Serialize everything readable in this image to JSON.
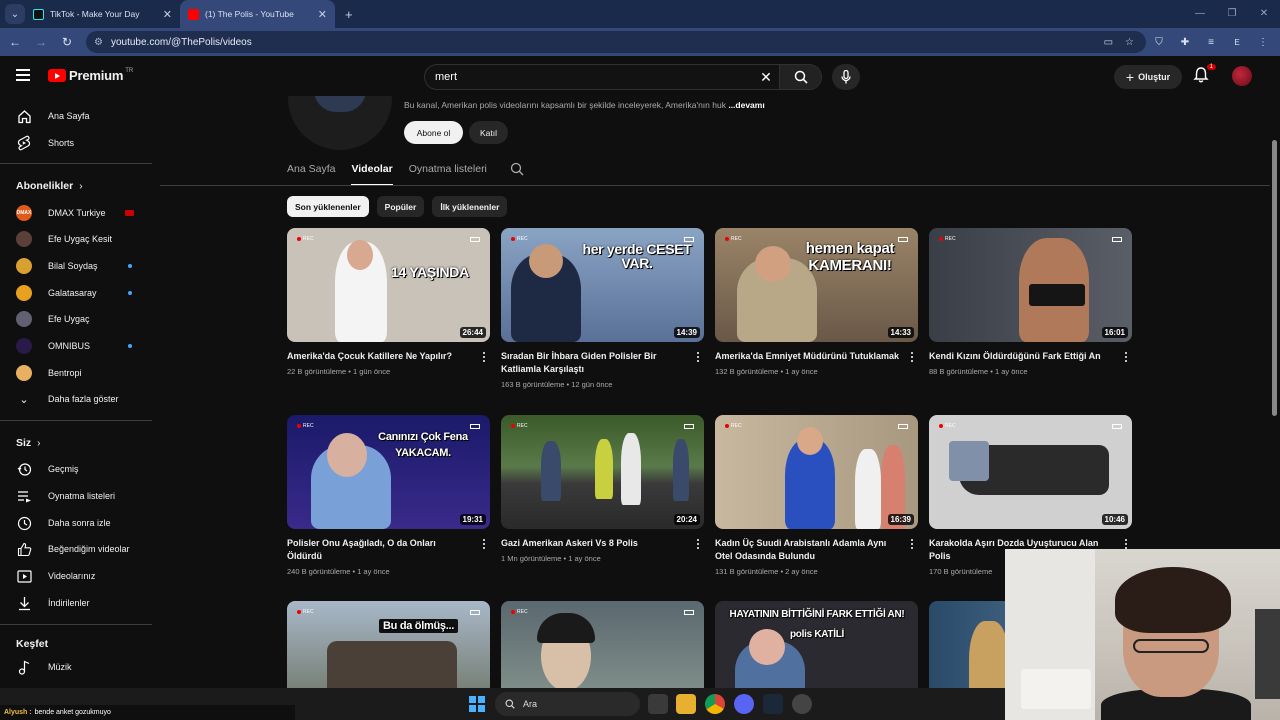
{
  "browser": {
    "tabs": [
      {
        "title": "TikTok - Make Your Day",
        "active": false
      },
      {
        "title": "(1) The Polis - YouTube",
        "active": true
      }
    ],
    "url": "youtube.com/@ThePolis/videos",
    "profile_letter": "E"
  },
  "header": {
    "logo_text": "Premium",
    "country_code": "TR",
    "search_value": "mert",
    "create_label": "Oluştur",
    "notification_count": "1"
  },
  "sidebar": {
    "main": [
      {
        "label": "Ana Sayfa",
        "icon": "home-icon"
      },
      {
        "label": "Shorts",
        "icon": "shorts-icon"
      }
    ],
    "subscriptions_heading": "Abonelikler",
    "subscriptions": [
      {
        "label": "DMAX Turkiye",
        "avatar_text": "DMAX",
        "color": "#e05a1a",
        "status": "live"
      },
      {
        "label": "Efe Uygaç Kesit",
        "avatar_text": "",
        "color": "#5a4038",
        "status": ""
      },
      {
        "label": "Bilal Soydaş",
        "avatar_text": "",
        "color": "#d8a030",
        "status": "new"
      },
      {
        "label": "Galatasaray",
        "avatar_text": "",
        "color": "#e8a020",
        "status": "new"
      },
      {
        "label": "Efe Uygaç",
        "avatar_text": "",
        "color": "#606070",
        "status": ""
      },
      {
        "label": "OMNIBUS",
        "avatar_text": "",
        "color": "#2a1a4a",
        "status": "new"
      },
      {
        "label": "Bentropi",
        "avatar_text": "",
        "color": "#e8b060",
        "status": ""
      }
    ],
    "show_more_label": "Daha fazla göster",
    "you_heading": "Siz",
    "you": [
      {
        "label": "Geçmiş",
        "icon": "history-icon"
      },
      {
        "label": "Oynatma listeleri",
        "icon": "playlists-icon"
      },
      {
        "label": "Daha sonra izle",
        "icon": "watch-later-icon"
      },
      {
        "label": "Beğendiğim videolar",
        "icon": "like-icon"
      },
      {
        "label": "Videolarınız",
        "icon": "your-videos-icon"
      },
      {
        "label": "İndirilenler",
        "icon": "download-icon"
      }
    ],
    "explore_heading": "Keşfet",
    "explore": [
      {
        "label": "Müzik",
        "icon": "music-icon"
      }
    ]
  },
  "channel": {
    "description": "Bu kanal, Amerikan polis videolarını kapsamlı bir şekilde inceleyerek, Amerika'nın huk",
    "more_label": "...devamı",
    "subscribe_label": "Abone ol",
    "join_label": "Katıl",
    "tabs": [
      "Ana Sayfa",
      "Videolar",
      "Oynatma listeleri"
    ],
    "active_tab": "Videolar",
    "chips": [
      "Son yüklenenler",
      "Popüler",
      "İlk yüklenenler"
    ]
  },
  "videos": [
    {
      "title": "Amerika'da Çocuk Katillere Ne Yapılır?",
      "stats": "22 B görüntüleme • 1 gün önce",
      "duration": "26:44",
      "caption": "14 YAŞINDA",
      "bg": "#c9c2b8",
      "fig": "#f4f4f4"
    },
    {
      "title": "Sıradan Bir İhbara Giden Polisler Bir Katliamla Karşılaştı",
      "stats": "163 B görüntüleme • 12 gün önce",
      "duration": "14:39",
      "caption": "her yerde CESET VAR.",
      "bg": "#6d86a8",
      "fig": "#1e2a44"
    },
    {
      "title": "Amerika'da Emniyet Müdürünü Tutuklamak",
      "stats": "132 B görüntüleme • 1 ay önce",
      "duration": "14:33",
      "caption": "hemen kapat KAMERANI!",
      "bg": "#8a7560",
      "fig": "#b8a888"
    },
    {
      "title": "Kendi Kızını Öldürdüğünü Fark Ettiği An",
      "stats": "88 B görüntüleme • 1 ay önce",
      "duration": "16:01",
      "caption": "",
      "bg": "#454a52",
      "fig": "#b07a5a"
    },
    {
      "title": "Polisler Onu Aşağıladı, O da Onları Öldürdü",
      "stats": "240 B görüntüleme • 1 ay önce",
      "duration": "19:31",
      "caption": "Canınızı Çok Fena YAKACAM.",
      "bg": "#1a1a6a",
      "fig": "#7aa0d8"
    },
    {
      "title": "Gazi Amerikan Askeri Vs 8 Polis",
      "stats": "1 Mn görüntüleme • 1 ay önce",
      "duration": "20:24",
      "caption": "",
      "bg": "#4a6a3a",
      "fig": "#3a3a3a"
    },
    {
      "title": "Kadın Üç Suudi Arabistanlı Adamla Aynı Otel Odasında Bulundu",
      "stats": "131 B görüntüleme • 2 ay önce",
      "duration": "16:39",
      "caption": "",
      "bg": "#b8a890",
      "fig": "#2a50c0"
    },
    {
      "title": "Karakolda Aşırı Dozda Uyuşturucu Alan Polis",
      "stats": "170 B görüntüleme",
      "duration": "10:46",
      "caption": "",
      "bg": "#c8c8c8",
      "fig": "#2a2a2a"
    },
    {
      "title": "",
      "stats": "",
      "duration": "",
      "caption": "Bu da ölmüş...",
      "bg": "#8a98a8",
      "fig": "#5a5048"
    },
    {
      "title": "",
      "stats": "",
      "duration": "",
      "caption": "",
      "bg": "#7a8890",
      "fig": "#d8c0a8"
    },
    {
      "title": "",
      "stats": "",
      "duration": "",
      "caption": "HAYATININ BİTTİĞİNİ FARK ETTİĞİ AN! polis KATİLİ",
      "bg": "#3a3a40",
      "fig": "#5070a0"
    },
    {
      "title": "",
      "stats": "",
      "duration": "",
      "caption": "",
      "bg": "#3a5a7a",
      "fig": "#c8a060"
    }
  ],
  "chat": {
    "user": "Alyush :",
    "message": "bende anket gozukmuyo"
  },
  "taskbar": {
    "search_placeholder": "Ara"
  }
}
